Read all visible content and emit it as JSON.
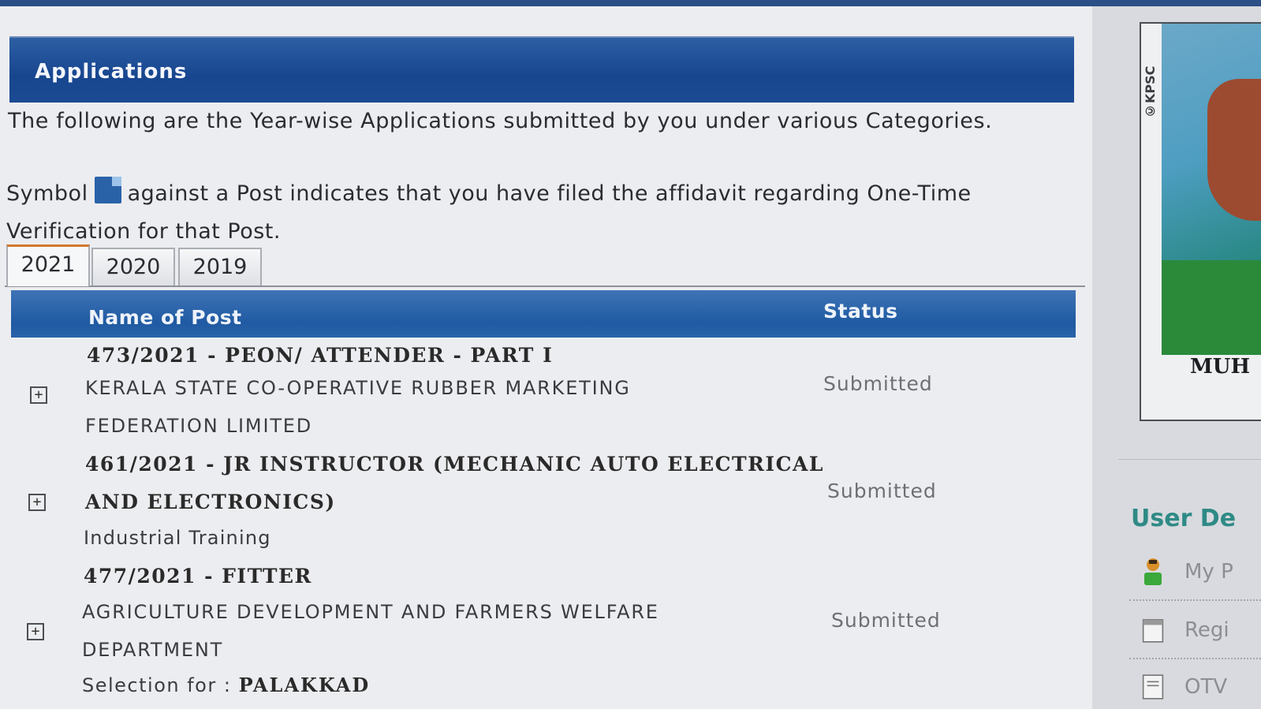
{
  "panel": {
    "title": "Applications",
    "intro": "The following are the Year-wise Applications submitted by you under various Categories.",
    "symbol_prefix": "Symbol",
    "symbol_suffix": "against a Post indicates that you have filed the affidavit regarding One-Time Verification for that Post."
  },
  "tabs": [
    {
      "label": "2021",
      "active": true
    },
    {
      "label": "2020",
      "active": false
    },
    {
      "label": "2019",
      "active": false
    }
  ],
  "table": {
    "headers": {
      "name": "Name of Post",
      "status": "Status"
    },
    "rows": [
      {
        "expander": "+",
        "post": "473/2021 - PEON/ ATTENDER - PART I",
        "dept_line1": "KERALA STATE CO-OPERATIVE RUBBER MARKETING",
        "dept_line2": "FEDERATION LIMITED",
        "status": "Submitted"
      },
      {
        "expander": "+",
        "post_line1": "461/2021 - JR INSTRUCTOR (MECHANIC AUTO ELECTRICAL",
        "post_line2": "AND ELECTRONICS)",
        "dept": "Industrial Training",
        "status": "Submitted"
      },
      {
        "expander": "+",
        "post": "477/2021 - FITTER",
        "dept_line1": "AGRICULTURE DEVELOPMENT AND FARMERS WELFARE",
        "dept_line2": "DEPARTMENT",
        "selection_label": "Selection for :",
        "selection_value": "PALAKKAD",
        "status": "Submitted"
      }
    ]
  },
  "sidebar": {
    "photo_tag": "©KPSC",
    "name_label": "MUH",
    "section_title": "User De",
    "menu": [
      {
        "label": "My P",
        "icon": "user-icon"
      },
      {
        "label": "Regi",
        "icon": "calendar-icon"
      },
      {
        "label": "OTV",
        "icon": "document-icon"
      }
    ]
  }
}
